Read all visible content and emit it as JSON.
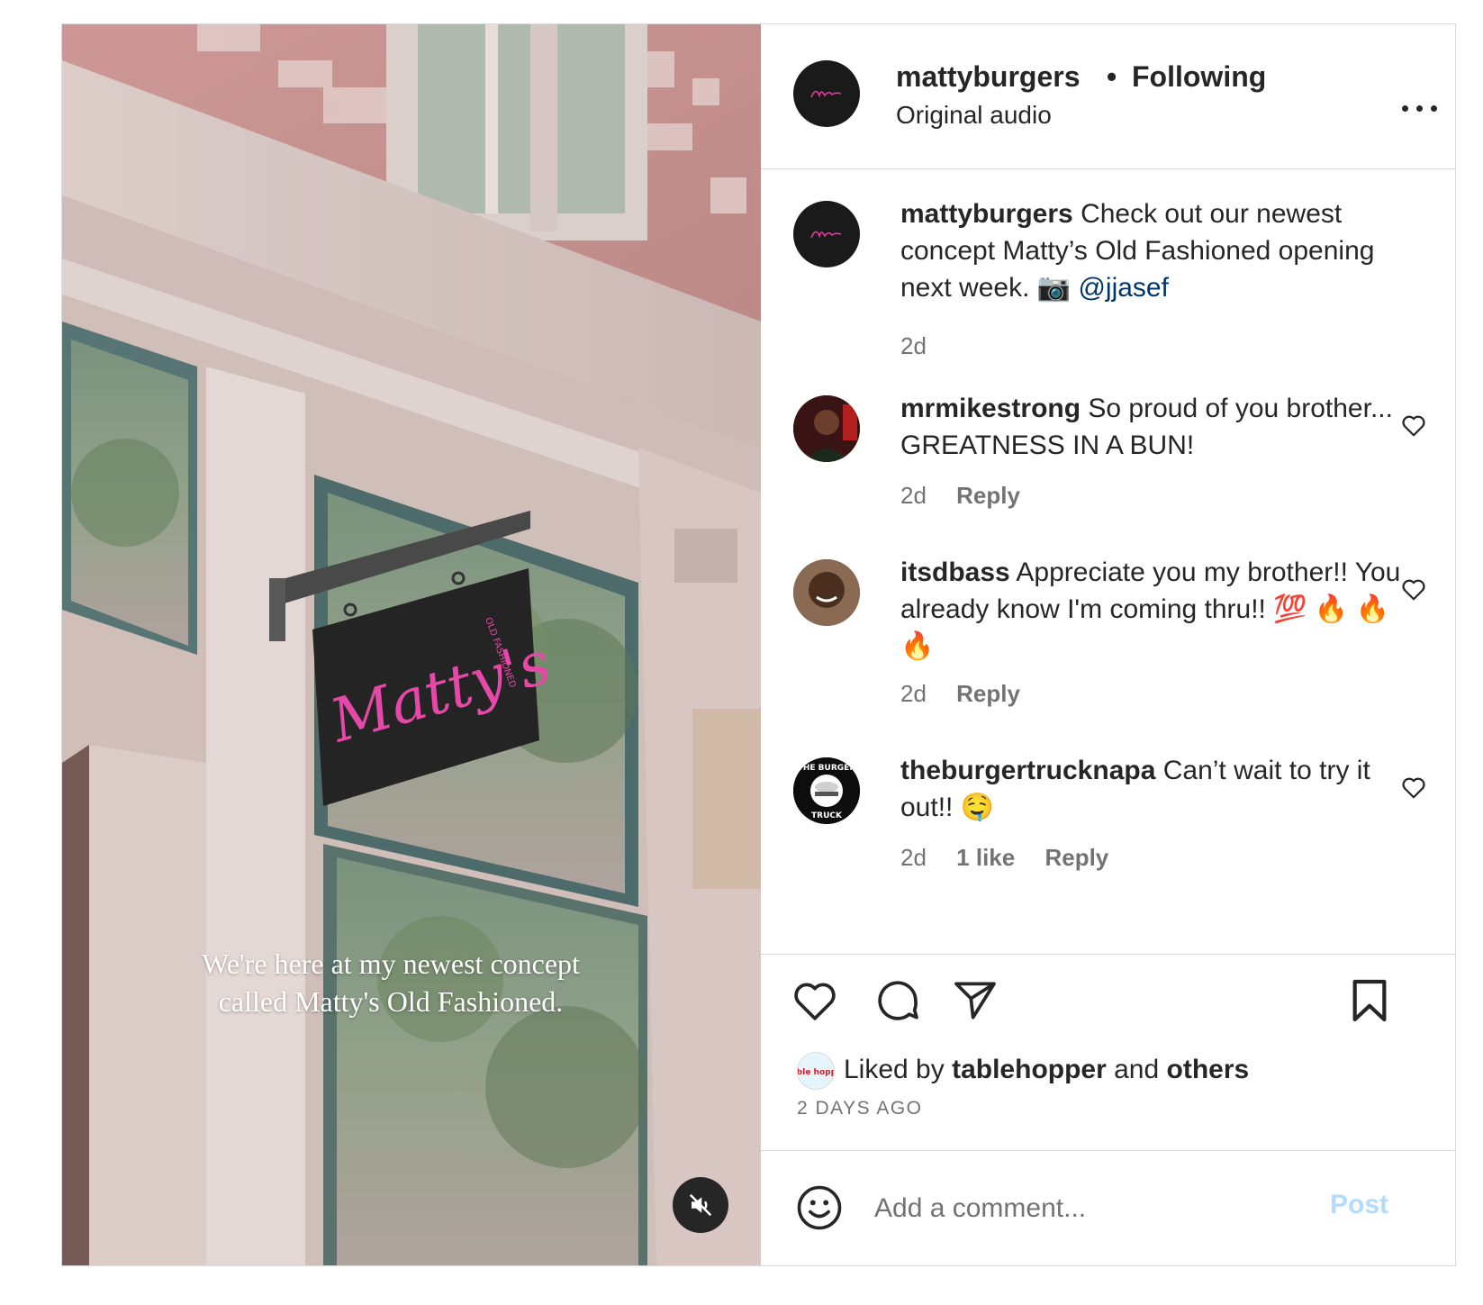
{
  "post": {
    "username": "mattyburgers",
    "separator": "•",
    "follow_status": "Following",
    "audio": "Original audio",
    "avatar_icon": "matty-logo-avatar",
    "media": {
      "overlay_line1": "We're here at my newest concept",
      "overlay_line2": "called Matty's Old Fashioned.",
      "sign_text": "Matty's",
      "sign_subtext": "OLD FASHIONED",
      "mute_icon": "speaker-muted-icon"
    },
    "caption": {
      "username": "mattyburgers",
      "text": "Check out our newest concept Matty’s Old Fashioned opening next week. 📷",
      "mention": "@jjasef",
      "time": "2d"
    },
    "comments": [
      {
        "username": "mrmikestrong",
        "text": "So proud of you brother... GREATNESS IN A BUN!",
        "time": "2d",
        "reply": "Reply"
      },
      {
        "username": "itsdbass",
        "text": "Appreciate you my brother!! You already know I'm coming thru!! 💯 🔥 🔥 🔥",
        "time": "2d",
        "reply": "Reply"
      },
      {
        "username": "theburgertrucknapa",
        "text": "Can’t wait to try it out!! 🤤",
        "time": "2d",
        "likes": "1 like",
        "reply": "Reply",
        "avatar_text_top": "THE BURGER",
        "avatar_text_bottom": "TRUCK"
      }
    ],
    "likes": {
      "prefix": "Liked by",
      "user": "tablehopper",
      "conj": "and",
      "others": "others",
      "mini_avatar_text": "table hopper"
    },
    "time_ago": "2 DAYS AGO",
    "add_comment": {
      "placeholder": "Add a comment...",
      "post_label": "Post"
    },
    "colors": {
      "text": "#262626",
      "muted": "#737373",
      "mention": "#00376b",
      "post_disabled": "#b3dbff",
      "border": "#dbdbdb"
    }
  }
}
